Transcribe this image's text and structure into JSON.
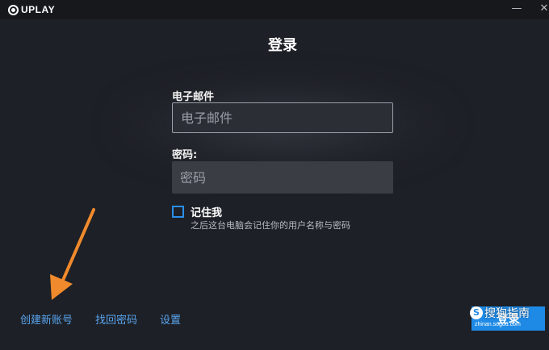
{
  "app": {
    "logo_text": "UPLAY"
  },
  "window_controls": {
    "minimize": "—",
    "close": "✕"
  },
  "page": {
    "title": "登录"
  },
  "form": {
    "email_label": "电子邮件",
    "email_placeholder": "电子邮件",
    "password_label": "密码:",
    "password_placeholder": "密码",
    "remember_label": "记住我",
    "remember_desc": "之后这台电脑会记住你的用户名称与密码",
    "remember_checked": false
  },
  "links": {
    "create_account": "创建新账号",
    "forgot_password": "找回密码",
    "settings": "设置"
  },
  "login_button": "登录",
  "watermark": {
    "badge": "S",
    "text": "搜狗指南",
    "url": "zhinan.sogou.com"
  },
  "colors": {
    "accent": "#1e8ae6",
    "link": "#5aa5f0",
    "annotation_arrow": "#f08a2c"
  }
}
